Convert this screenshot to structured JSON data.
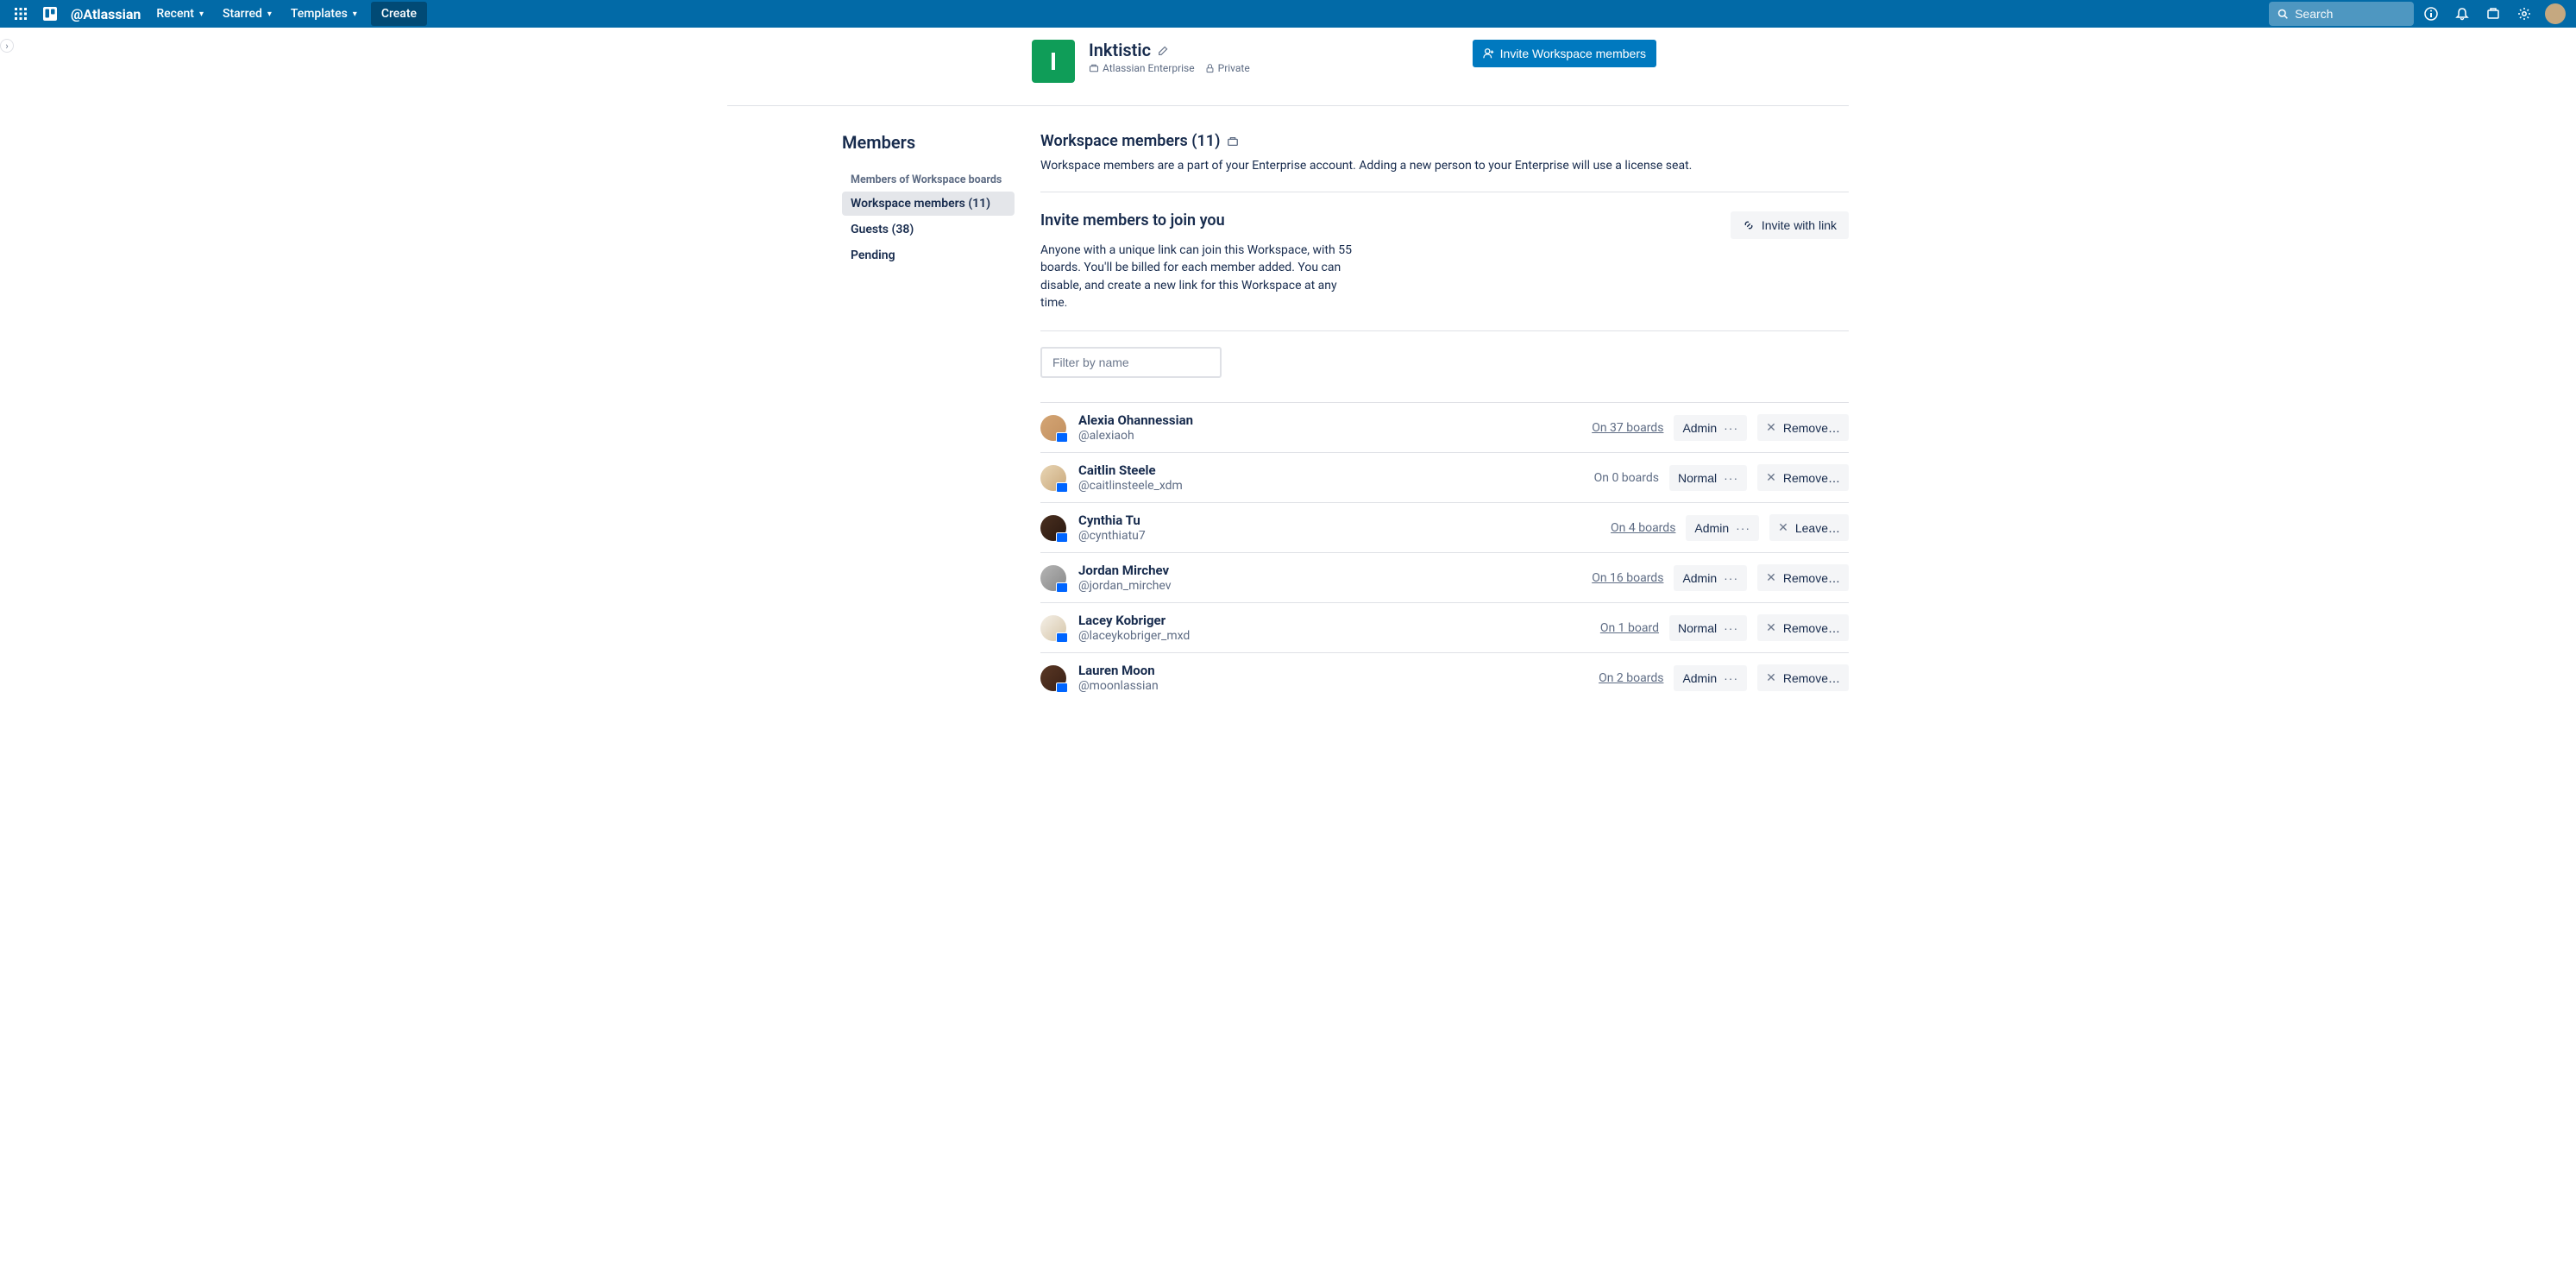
{
  "nav": {
    "logo": "@Atlassian",
    "items": [
      "Recent",
      "Starred",
      "Templates"
    ],
    "create": "Create",
    "search_placeholder": "Search"
  },
  "workspace": {
    "initial": "I",
    "name": "Inktistic",
    "enterprise_label": "Atlassian Enterprise",
    "visibility": "Private",
    "invite_button": "Invite Workspace members"
  },
  "sidebar": {
    "heading": "Members",
    "items": [
      {
        "label": "Members of Workspace boards",
        "active": false,
        "sub": true
      },
      {
        "label": "Workspace members (11)",
        "active": true,
        "sub": false
      },
      {
        "label": "Guests (38)",
        "active": false,
        "sub": false
      },
      {
        "label": "Pending",
        "active": false,
        "sub": false
      }
    ]
  },
  "section": {
    "title": "Workspace members (11)",
    "description": "Workspace members are a part of your Enterprise account. Adding a new person to your Enterprise will use a license seat."
  },
  "invite": {
    "title": "Invite members to join you",
    "body": "Anyone with a unique link can join this Workspace, with 55 boards. You'll be billed for each member added. You can disable, and create a new link for this Workspace at any time.",
    "button": "Invite with link"
  },
  "filter": {
    "placeholder": "Filter by name"
  },
  "members": [
    {
      "name": "Alexia Ohannessian",
      "handle": "@alexiaoh",
      "boards": "On 37 boards",
      "boards_link": true,
      "role": "Admin",
      "action": "Remove…",
      "av": "av1"
    },
    {
      "name": "Caitlin Steele",
      "handle": "@caitlinsteele_xdm",
      "boards": "On 0 boards",
      "boards_link": false,
      "role": "Normal",
      "action": "Remove…",
      "av": "av2"
    },
    {
      "name": "Cynthia Tu",
      "handle": "@cynthiatu7",
      "boards": "On 4 boards",
      "boards_link": true,
      "role": "Admin",
      "action": "Leave…",
      "av": "av3"
    },
    {
      "name": "Jordan Mirchev",
      "handle": "@jordan_mirchev",
      "boards": "On 16 boards",
      "boards_link": true,
      "role": "Admin",
      "action": "Remove…",
      "av": "av4"
    },
    {
      "name": "Lacey Kobriger",
      "handle": "@laceykobriger_mxd",
      "boards": "On 1 board",
      "boards_link": true,
      "role": "Normal",
      "action": "Remove…",
      "av": "av5"
    },
    {
      "name": "Lauren Moon",
      "handle": "@moonlassian",
      "boards": "On 2 boards",
      "boards_link": true,
      "role": "Admin",
      "action": "Remove…",
      "av": "av6"
    }
  ]
}
